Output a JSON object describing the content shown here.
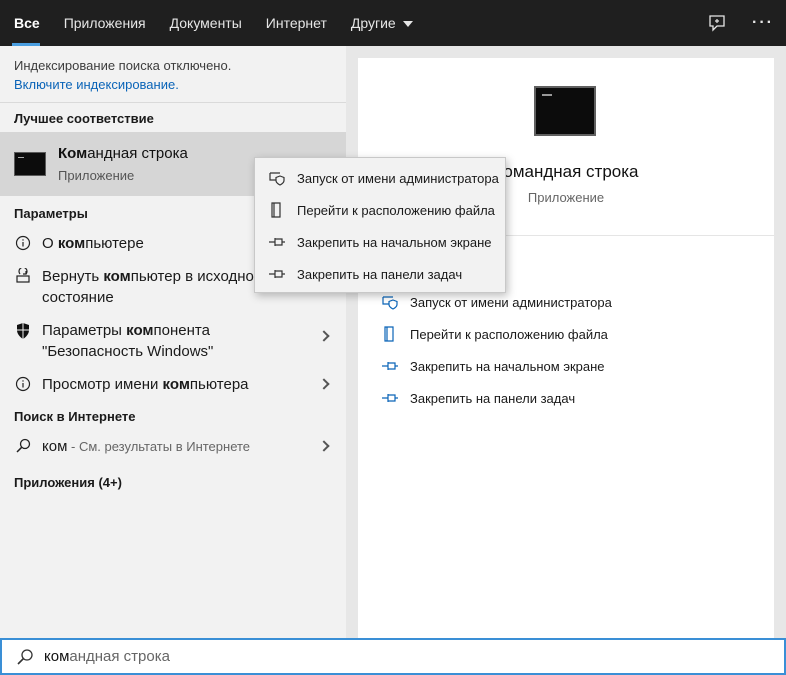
{
  "tabs": [
    {
      "label": "Все",
      "active": true
    },
    {
      "label": "Приложения"
    },
    {
      "label": "Документы"
    },
    {
      "label": "Интернет"
    },
    {
      "label": "Другие"
    }
  ],
  "topbar_icons": [
    "feedback-icon",
    "more-icon"
  ],
  "notice": {
    "text": "Индексирование поиска отключено.",
    "link": "Включите индексирование."
  },
  "best_match": {
    "section": "Лучшее соответствие",
    "title_bold": "Ком",
    "title_rest": "андная строка",
    "subtitle": "Приложение"
  },
  "settings": {
    "section": "Параметры",
    "items": [
      {
        "pre": "О ",
        "bold": "ком",
        "post": "пьютере",
        "icon": "info-icon"
      },
      {
        "pre": "Вернуть ",
        "bold": "ком",
        "post": "пьютер в исходное состояние",
        "icon": "reset-pc-icon"
      },
      {
        "pre": "Параметры ",
        "bold": "ком",
        "post": "понента \"Безопасность Windows\"",
        "icon": "shield-icon"
      },
      {
        "pre": "Просмотр имени ",
        "bold": "ком",
        "post": "пьютера",
        "icon": "info-icon"
      }
    ]
  },
  "web": {
    "section": "Поиск в Интернете",
    "query": "ком",
    "hint": " - См. результаты в Интернете"
  },
  "apps_section": "Приложения (4+)",
  "preview": {
    "name": "Командная строка",
    "type": "Приложение"
  },
  "actions": [
    {
      "label": "Запуск от имени администратора",
      "icon": "admin-shield-icon"
    },
    {
      "label": "Перейти к расположению файла",
      "icon": "file-location-icon"
    },
    {
      "label": "Закрепить на начальном экране",
      "icon": "pin-icon"
    },
    {
      "label": "Закрепить на панели задач",
      "icon": "pin-icon"
    }
  ],
  "search": {
    "typed": "ком",
    "rest": "андная строка"
  }
}
